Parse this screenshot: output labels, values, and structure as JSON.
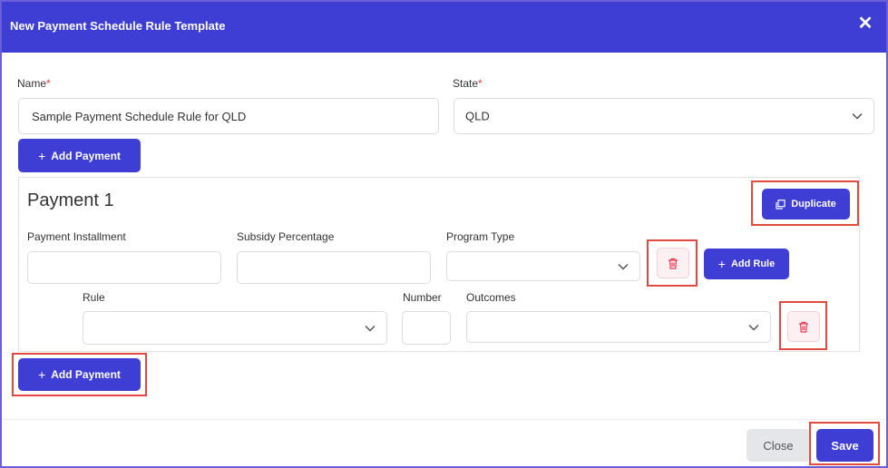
{
  "dialog": {
    "title": "New Payment Schedule Rule Template",
    "close_symbol": "✕"
  },
  "form": {
    "name": {
      "label": "Name",
      "required_mark": "*",
      "value": "Sample Payment Schedule Rule for QLD"
    },
    "state": {
      "label": "State",
      "required_mark": "*",
      "value": "QLD"
    },
    "add_payment_top": {
      "icon": "+",
      "label": "Add Payment"
    }
  },
  "payment": {
    "title": "Payment 1",
    "duplicate_label": "Duplicate",
    "fields": {
      "installment_label": "Payment Installment",
      "installment_value": "",
      "subsidy_label": "Subsidy Percentage",
      "subsidy_value": "",
      "program_type_label": "Program Type",
      "program_type_value": ""
    },
    "add_rule": {
      "icon": "+",
      "label": "Add Rule"
    },
    "rule_row": {
      "rule_label": "Rule",
      "rule_value": "",
      "number_label": "Number",
      "number_value": "",
      "outcomes_label": "Outcomes",
      "outcomes_value": ""
    }
  },
  "add_payment_bottom": {
    "icon": "+",
    "label": "Add Payment"
  },
  "footer": {
    "close_label": "Close",
    "save_label": "Save"
  },
  "colors": {
    "primary": "#3f3ed4",
    "highlight": "#e04a3f",
    "danger": "#e53950"
  }
}
